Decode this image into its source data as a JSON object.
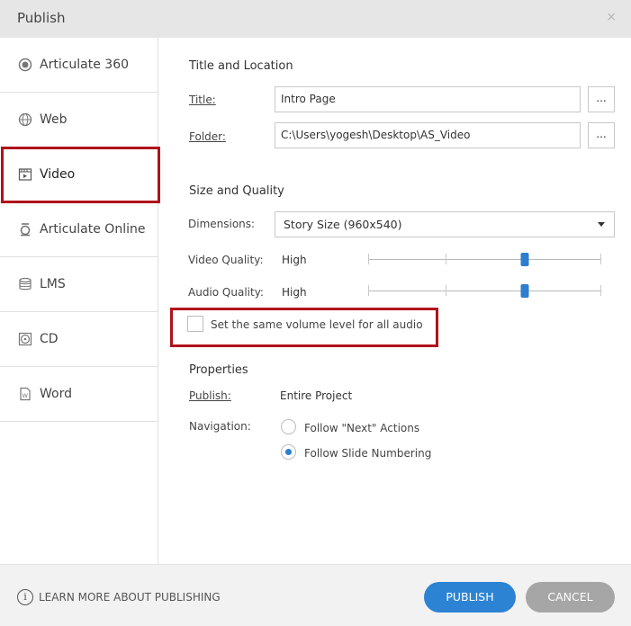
{
  "window": {
    "title": "Publish",
    "close_glyph": "×"
  },
  "sidebar": {
    "items": [
      {
        "label": "Articulate 360",
        "icon": "articulate-360-icon"
      },
      {
        "label": "Web",
        "icon": "globe-icon"
      },
      {
        "label": "Video",
        "icon": "video-icon",
        "selected": true
      },
      {
        "label": "Articulate Online",
        "icon": "articulate-online-icon"
      },
      {
        "label": "LMS",
        "icon": "database-icon"
      },
      {
        "label": "CD",
        "icon": "disc-icon"
      },
      {
        "label": "Word",
        "icon": "word-document-icon"
      }
    ]
  },
  "title_location": {
    "heading": "Title and Location",
    "title_label": "Title:",
    "title_value": "Intro Page",
    "folder_label": "Folder:",
    "folder_value": "C:\\Users\\yogesh\\Desktop\\AS_Video",
    "browse_label": "..."
  },
  "size_quality": {
    "heading": "Size and Quality",
    "dimensions_label": "Dimensions:",
    "dimensions_value": "Story Size (960x540)",
    "video_quality_label": "Video Quality:",
    "video_quality_value": "High",
    "video_quality_level": 0.67,
    "audio_quality_label": "Audio Quality:",
    "audio_quality_value": "High",
    "audio_quality_level": 0.67,
    "same_volume_label": "Set the same volume level for all audio",
    "same_volume_checked": false
  },
  "properties": {
    "heading": "Properties",
    "publish_label": "Publish:",
    "publish_value": "Entire Project",
    "navigation_label": "Navigation:",
    "nav_options": [
      {
        "label": "Follow \"Next\" Actions",
        "selected": false
      },
      {
        "label": "Follow Slide Numbering",
        "selected": true
      }
    ]
  },
  "footer": {
    "learn_more": "LEARN MORE ABOUT PUBLISHING",
    "publish_button": "PUBLISH",
    "cancel_button": "CANCEL"
  },
  "colors": {
    "accent": "#2d83d3",
    "highlight": "#b0121b",
    "cancel": "#a6a6a6"
  }
}
